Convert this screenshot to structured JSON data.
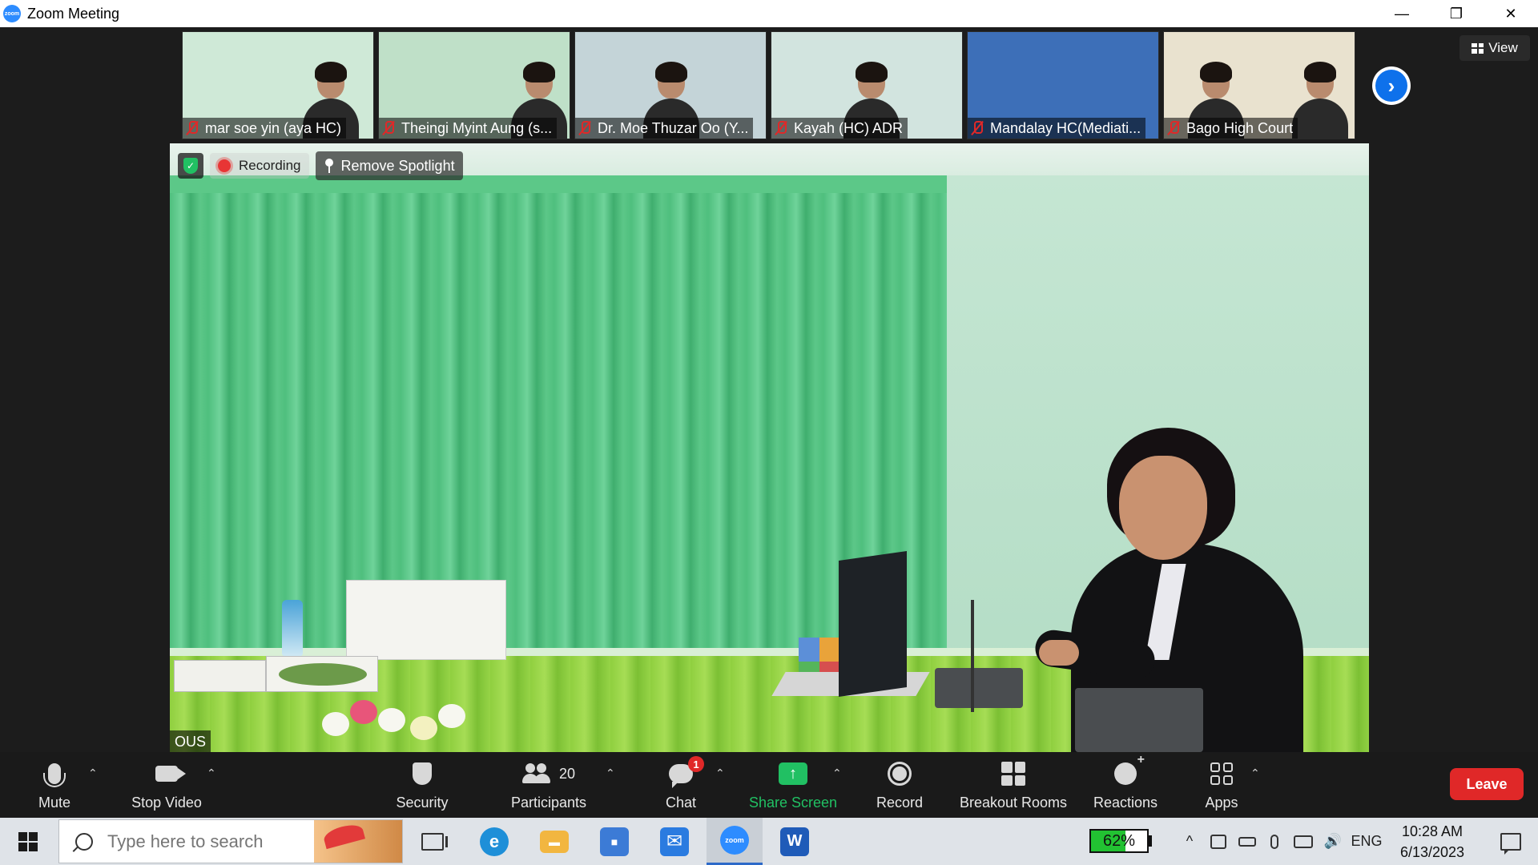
{
  "window": {
    "title": "Zoom Meeting",
    "logo_text": "zoom",
    "controls": {
      "minimize": "—",
      "restore": "❐",
      "close": "✕"
    }
  },
  "thumbnails": [
    {
      "name": "mar soe yin (aya HC)",
      "muted": true,
      "bg": "#cfe9d7"
    },
    {
      "name": "Theingi Myint Aung (s...",
      "muted": true,
      "bg": "#bfe0c8"
    },
    {
      "name": "Dr. Moe Thuzar Oo (Y...",
      "muted": true,
      "bg": "#c4d4d8"
    },
    {
      "name": "Kayah (HC) ADR",
      "muted": true,
      "bg": "#d2e4df"
    },
    {
      "name": "Mandalay HC(Mediati...",
      "muted": true,
      "bg": "#3d6fb8"
    },
    {
      "name": "Bago High Court",
      "muted": true,
      "bg": "#e9e2cf"
    }
  ],
  "next_page_icon": "chevron-right-icon",
  "next_page_glyph": "›",
  "view_button": {
    "label": "View"
  },
  "main_video": {
    "recording_label": "Recording",
    "security_glyph": "✓",
    "remove_spotlight_label": "Remove Spotlight",
    "name_tag": "OUS"
  },
  "toolbar": {
    "mute": "Mute",
    "stop_video": "Stop Video",
    "security": "Security",
    "participants": "Participants",
    "participants_count": "20",
    "chat": "Chat",
    "chat_badge": "1",
    "share_screen": "Share Screen",
    "share_glyph": "↑",
    "record": "Record",
    "breakout_rooms": "Breakout Rooms",
    "reactions": "Reactions",
    "apps": "Apps",
    "leave": "Leave",
    "caret": "⌃"
  },
  "taskbar": {
    "search_placeholder": "Type here to search",
    "battery_percent": "62%",
    "battery_level": 0.62,
    "language": "ENG",
    "time": "10:28 AM",
    "date": "6/13/2023",
    "apps": [
      {
        "name": "edge",
        "color": "#1e8fd8",
        "glyph": "e"
      },
      {
        "name": "file-explorer",
        "color": "#f2b640",
        "glyph": "▬"
      },
      {
        "name": "store",
        "color": "#3c7bd6",
        "glyph": "■"
      },
      {
        "name": "mail",
        "color": "#2a7be0",
        "glyph": "✉"
      },
      {
        "name": "zoom",
        "color": "#2d8cff",
        "glyph": "zoom"
      },
      {
        "name": "word",
        "color": "#1f5bb8",
        "glyph": "W"
      }
    ],
    "tray_up_glyph": "^",
    "volume_glyph": "🔊"
  }
}
